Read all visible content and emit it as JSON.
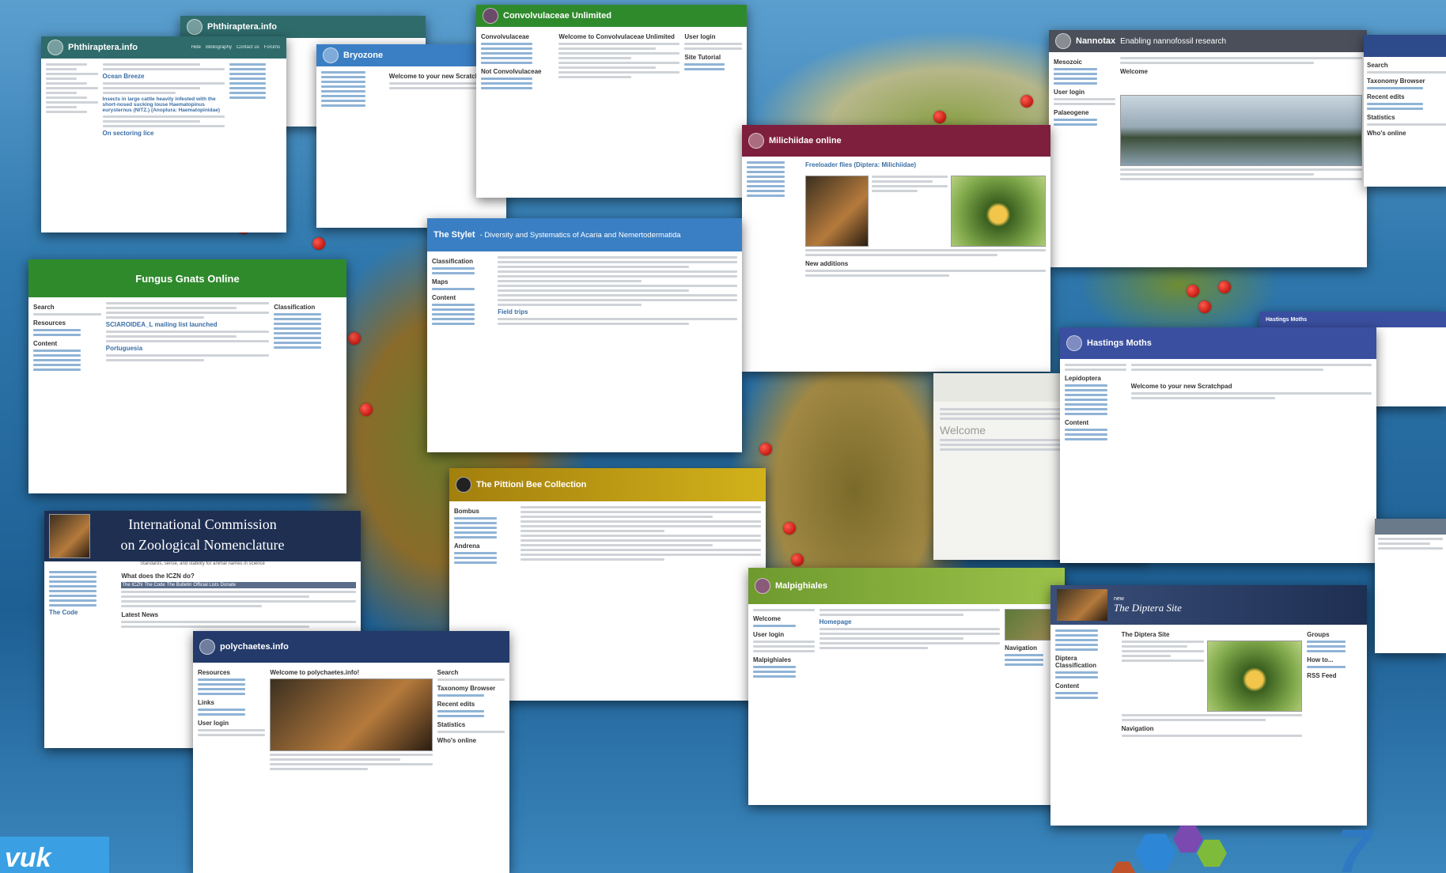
{
  "sites": {
    "phthiraptera": {
      "title": "Phthiraptera.info",
      "nav": [
        "Hide",
        "Bibliography",
        "Contact us",
        "Forums"
      ],
      "post1_title": "Ocean Breeze",
      "post2_title": "Insects in large cattle heavily infested with the short-nosed sucking louse Haematopinus eurysternus (NITZ.) (Anoplura: Haematopinidae)",
      "post3_title": "On sectoring lice"
    },
    "phthiraptera_back": {
      "title": "Phthiraptera.info"
    },
    "bryozone": {
      "title": "Bryozone",
      "welcome": "Welcome to your new Scratchpad"
    },
    "convolvulaceae": {
      "title": "Convolvulaceae Unlimited",
      "welcome": "Welcome to Convolvulaceae Unlimited",
      "side_heading": "Convolvulaceae",
      "side_heading2": "Not Convolvulaceae",
      "login": "User login",
      "tutorial": "Site Tutorial"
    },
    "nannotax": {
      "title": "Nannotax",
      "tagline": "Enabling nannofossil research",
      "welcome": "Welcome",
      "login": "User login",
      "side1": "Mesozoic",
      "side2": "Palaeogene"
    },
    "milichiidae": {
      "title": "Milichiidae online",
      "post_title": "Freeloader flies (Diptera: Milichiidae)",
      "new_additions": "New additions"
    },
    "fungus": {
      "title": "Fungus Gnats Online",
      "search": "Search",
      "resources": "Resources",
      "content": "Content",
      "classification": "Classification",
      "news_title": "SCIAROIDEA_L mailing list launched",
      "post2": "Portuguesia"
    },
    "stylet": {
      "title": "The Stylet",
      "tagline": "- Diversity and Systematics of Acaria and Nemertodermatida",
      "classification": "Classification",
      "maps": "Maps",
      "content": "Content",
      "field_trips": "Field trips"
    },
    "hastings": {
      "title": "Hastings Moths",
      "welcome": "Welcome to your new Scratchpad",
      "side": "Lepidoptera",
      "content": "Content"
    },
    "hastings_back": {
      "title": "Hastings Moths"
    },
    "welcome_site": {
      "heading": "Welcome"
    },
    "iczn": {
      "title_line1": "International Commission",
      "title_line2": "on Zoological Nomenclature",
      "tagline": "Standards, sense, and stability for animal names in science",
      "question": "What does the ICZN do?",
      "tabs": [
        "The ICZN",
        "The Code",
        "The Bulletin",
        "Official Lists",
        "Donate"
      ],
      "latest": "Latest News",
      "bottom_link": "The Code"
    },
    "pollen_bee": {
      "title": "The Pittioni Bee Collection",
      "side1": "Bombus",
      "side2": "Andrena"
    },
    "polychaetes": {
      "title": "polychaetes.info",
      "welcome": "Welcome to polychaetes.info!",
      "resources": "Resources",
      "links": "Links",
      "login": "User login",
      "search": "Search",
      "taxonomy": "Taxonomy Browser",
      "recent": "Recent edits",
      "stats": "Statistics",
      "online": "Who's online"
    },
    "malpighiales": {
      "title": "Malpighiales",
      "homepage": "Homepage",
      "welcome": "Welcome",
      "login": "User login",
      "navigation": "Navigation",
      "side2": "Malpighiales"
    },
    "diptera": {
      "brand_small": "new",
      "title": "The Diptera Site",
      "post_title": "The Diptera Site",
      "side1": "Diptera Classification",
      "side2": "Content",
      "groups": "Groups",
      "how_to": "How to...",
      "rss": "RSS Feed",
      "nav_heading": "Navigation"
    },
    "right_edge": {
      "search": "Search",
      "taxonomy": "Taxonomy Browser",
      "recent": "Recent edits",
      "stats": "Statistics",
      "online": "Who's online"
    }
  },
  "footer": {
    "brand_text": "vuk"
  },
  "colors": {
    "teal_header": "#2f6b6b",
    "green_header": "#2f8a2c",
    "blue_header": "#3a7fc4",
    "maroon_header": "#7d1f3d",
    "slate_header": "#4a4f5a",
    "gold_header": "#c8a012",
    "navy_header": "#233a6a",
    "lime_header": "#8bb33a"
  }
}
